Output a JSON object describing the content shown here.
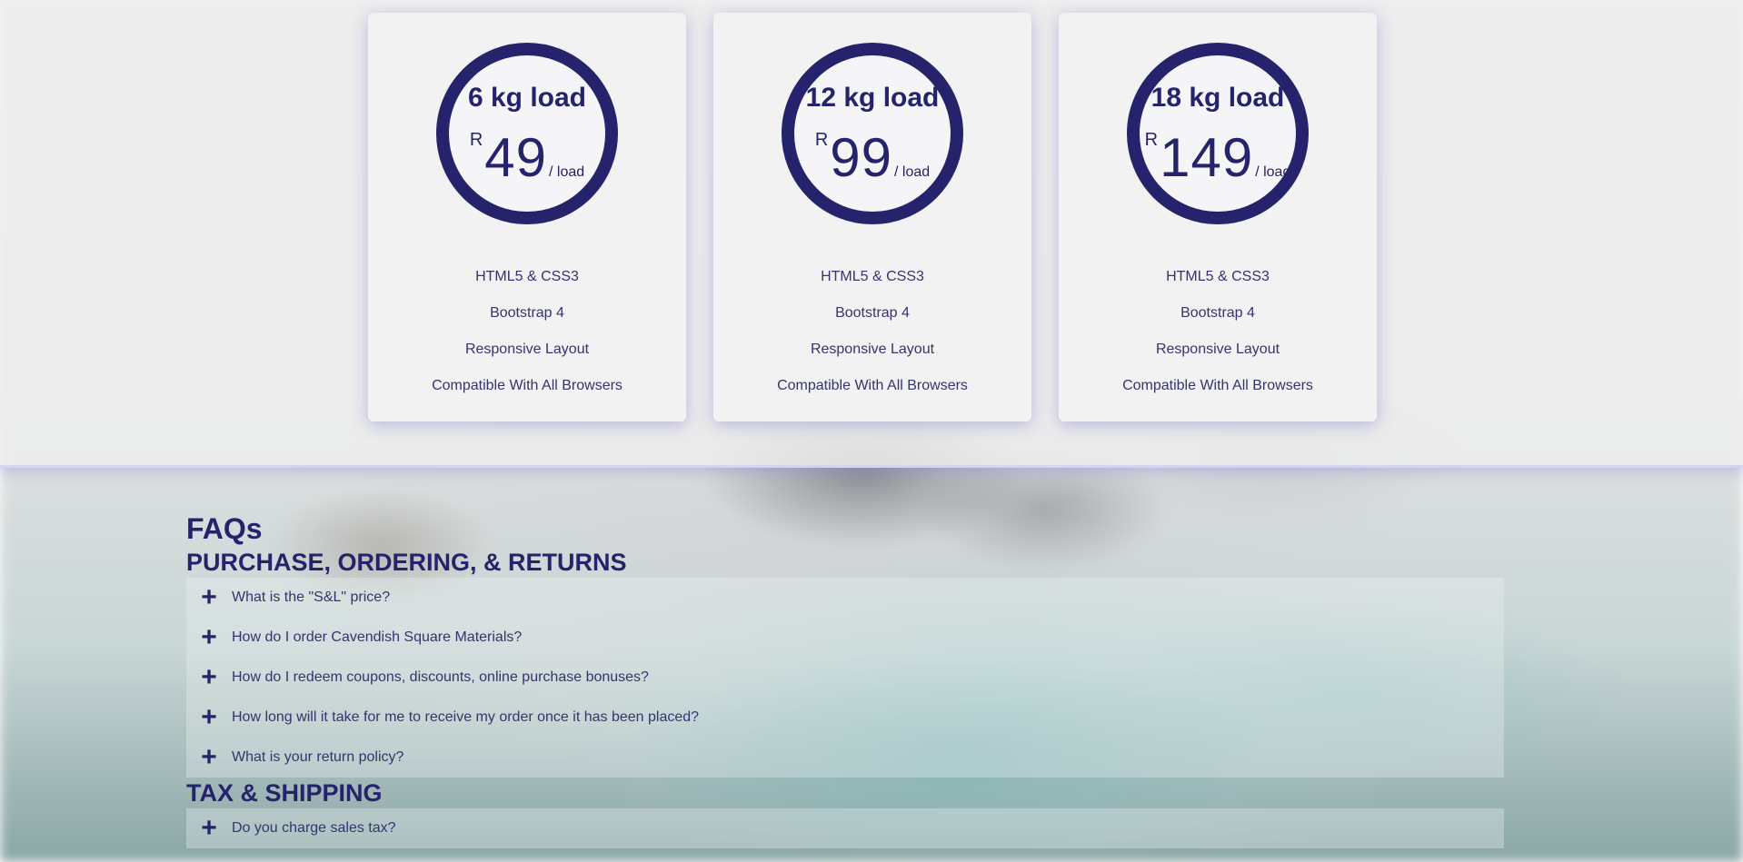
{
  "pricing": {
    "cards": [
      {
        "load": "6 kg load",
        "currency": "R",
        "amount": "49",
        "per": "/ load",
        "features": [
          "HTML5 & CSS3",
          "Bootstrap 4",
          "Responsive Layout",
          "Compatible With All Browsers"
        ]
      },
      {
        "load": "12 kg load",
        "currency": "R",
        "amount": "99",
        "per": "/ load",
        "features": [
          "HTML5 & CSS3",
          "Bootstrap 4",
          "Responsive Layout",
          "Compatible With All Browsers"
        ]
      },
      {
        "load": "18 kg load",
        "currency": "R",
        "amount": "149",
        "per": "/ load",
        "features": [
          "HTML5 & CSS3",
          "Bootstrap 4",
          "Responsive Layout",
          "Compatible With All Browsers"
        ]
      }
    ]
  },
  "faq": {
    "title": "FAQs",
    "sections": [
      {
        "heading": "PURCHASE, ORDERING, & RETURNS",
        "questions": [
          "What is the \"S&L\" price?",
          "How do I order Cavendish Square Materials?",
          "How do I redeem coupons, discounts, online purchase bonuses?",
          "How long will it take for me to receive my order once it has been placed?",
          "What is your return policy?"
        ]
      },
      {
        "heading": "TAX & SHIPPING",
        "questions": [
          "Do you charge sales tax?"
        ]
      }
    ],
    "expand_icon": "plus-icon"
  },
  "colors": {
    "brand": "#25236b",
    "card_bg": "#f2f2f2"
  }
}
